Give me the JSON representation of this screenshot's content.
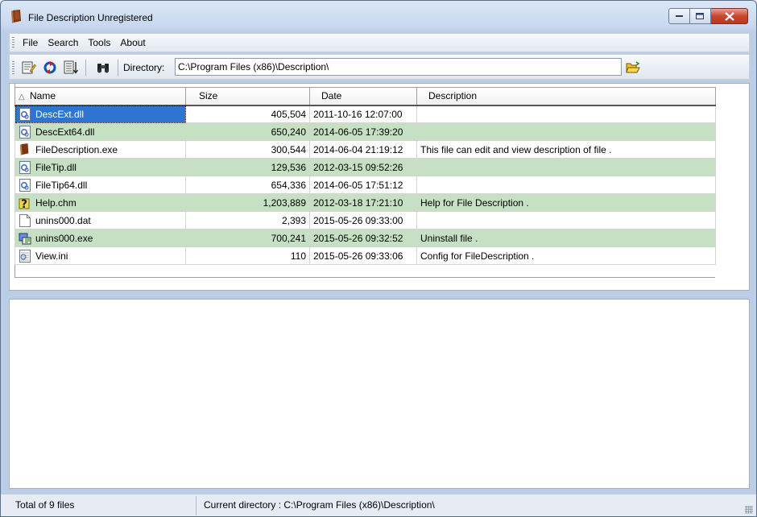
{
  "window": {
    "title": "File Description Unregistered"
  },
  "menu": {
    "items": [
      "File",
      "Search",
      "Tools",
      "About"
    ]
  },
  "toolbar": {
    "buttons": [
      "edit-description-icon",
      "refresh-icon",
      "sort-list-icon",
      "find-binoculars-icon"
    ],
    "directory_label": "Directory:",
    "directory_value": "C:\\Program Files (x86)\\Description\\",
    "browse_icon": "open-folder-icon"
  },
  "file_list": {
    "columns": [
      "Name",
      "Size",
      "Date",
      "Description"
    ],
    "sort_indicator": "△",
    "rows": [
      {
        "name": "DescExt.dll",
        "size": "405,504",
        "date": "2011-10-16 12:07:00",
        "description": "",
        "icon": "dll-icon"
      },
      {
        "name": "DescExt64.dll",
        "size": "650,240",
        "date": "2014-06-05 17:39:20",
        "description": "",
        "icon": "dll-icon"
      },
      {
        "name": "FileDescription.exe",
        "size": "300,544",
        "date": "2014-06-04 21:19:12",
        "description": "This file can edit and view description of file .",
        "icon": "book-icon"
      },
      {
        "name": "FileTip.dll",
        "size": "129,536",
        "date": "2012-03-15 09:52:26",
        "description": "",
        "icon": "dll-icon"
      },
      {
        "name": "FileTip64.dll",
        "size": "654,336",
        "date": "2014-06-05 17:51:12",
        "description": "",
        "icon": "dll-icon"
      },
      {
        "name": "Help.chm",
        "size": "1,203,889",
        "date": "2012-03-18 17:21:10",
        "description": "Help for File Description .",
        "icon": "help-icon"
      },
      {
        "name": "unins000.dat",
        "size": "2,393",
        "date": "2015-05-26 09:33:00",
        "description": "",
        "icon": "blank-file-icon"
      },
      {
        "name": "unins000.exe",
        "size": "700,241",
        "date": "2015-05-26 09:32:52",
        "description": "Uninstall file .",
        "icon": "installer-icon"
      },
      {
        "name": "View.ini",
        "size": "110",
        "date": "2015-05-26 09:33:06",
        "description": "Config for FileDescription .",
        "icon": "ini-icon"
      }
    ]
  },
  "status": {
    "total": "Total of 9 files",
    "current_dir": "Current directory : C:\\Program Files (x86)\\Description\\"
  },
  "colors": {
    "alt_row": "#c5e0c2",
    "selection": "#2f74d0",
    "close_button": "#c9452c"
  }
}
